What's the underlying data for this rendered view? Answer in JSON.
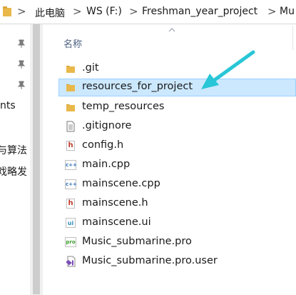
{
  "address_bar": {
    "crumbs": [
      "此电脑",
      "WS (F:)",
      "Freshman_year_project",
      "Mu"
    ],
    "separator": ">"
  },
  "nav_pane": {
    "fragments": [
      "nts",
      "与算法",
      "戏略发"
    ]
  },
  "column_header": {
    "name": "名称"
  },
  "files": [
    {
      "name": ".git",
      "type": "folder",
      "selected": false
    },
    {
      "name": "resources_for_project",
      "type": "folder",
      "selected": true
    },
    {
      "name": "temp_resources",
      "type": "folder",
      "selected": false
    },
    {
      "name": ".gitignore",
      "type": "text-file",
      "selected": false
    },
    {
      "name": "config.h",
      "type": "header-file",
      "selected": false
    },
    {
      "name": "main.cpp",
      "type": "cpp-file",
      "selected": false
    },
    {
      "name": "mainscene.cpp",
      "type": "cpp-file",
      "selected": false
    },
    {
      "name": "mainscene.h",
      "type": "header-file",
      "selected": false
    },
    {
      "name": "mainscene.ui",
      "type": "ui-file",
      "selected": false
    },
    {
      "name": "Music_submarine.pro",
      "type": "pro-file",
      "selected": false
    },
    {
      "name": "Music_submarine.pro.user",
      "type": "user-file",
      "selected": false
    }
  ],
  "icon_badges": {
    "header-file": "h",
    "cpp-file": "c++",
    "ui-file": "ui",
    "pro-file": "pro"
  },
  "colors": {
    "selection_bg": "#cce8ff",
    "selection_border": "#99d1ff",
    "folder": "#e8b84a",
    "annotation_arrow": "#28c6d6"
  }
}
